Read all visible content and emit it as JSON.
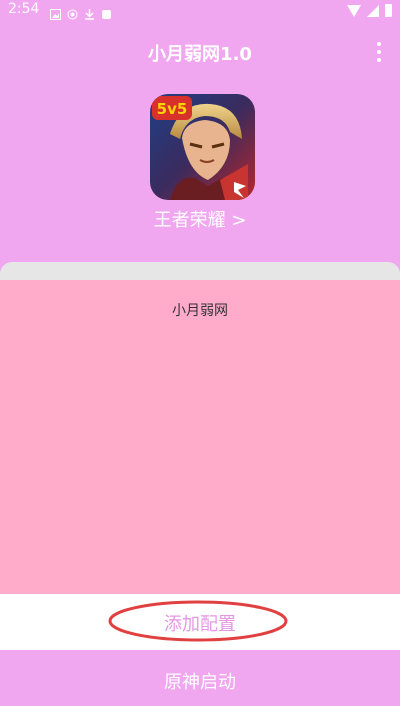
{
  "status_bar": {
    "time": "2:54"
  },
  "app_bar": {
    "title": "小月弱网1.0"
  },
  "game": {
    "name": "王者荣耀 >",
    "icon_badge": "5v5"
  },
  "card": {
    "title": "小月弱网"
  },
  "actions": {
    "add_config_label": "添加配置",
    "start_label": "原神启动"
  },
  "colors": {
    "background": "#f0a7f0",
    "card": "#ffabc9",
    "card_top": "#e6e6e6",
    "accent_text": "#e597e5",
    "highlight_ring": "#e04040"
  }
}
